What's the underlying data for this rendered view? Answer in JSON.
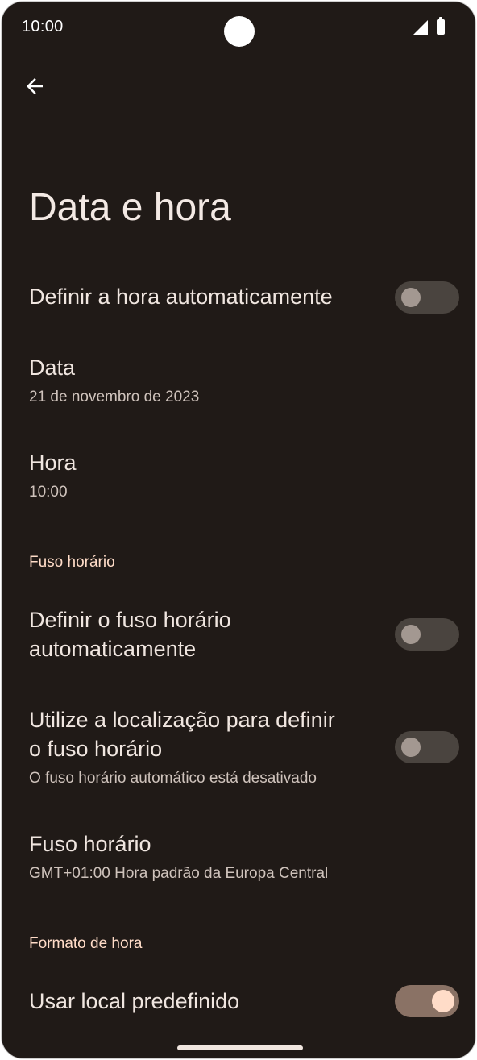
{
  "status_bar": {
    "time": "10:00"
  },
  "header": {
    "title": "Data e hora"
  },
  "settings": {
    "auto_time": {
      "label": "Definir a hora automaticamente",
      "enabled": false
    },
    "date": {
      "label": "Data",
      "value": "21 de novembro de 2023"
    },
    "time": {
      "label": "Hora",
      "value": "10:00"
    },
    "timezone_section": "Fuso horário",
    "auto_timezone": {
      "label_line1": "Definir o fuso horário",
      "label_line2": "automaticamente",
      "enabled": false
    },
    "location_timezone": {
      "label_line1": "Utilize a localização para definir",
      "label_line2": "o fuso horário",
      "summary": "O fuso horário automático está desativado",
      "enabled": false
    },
    "timezone": {
      "label": "Fuso horário",
      "value": "GMT+01:00 Hora padrão da Europa Central"
    },
    "format_section": "Formato de hora",
    "locale_default": {
      "label": "Usar local predefinido",
      "enabled": true
    }
  },
  "icons": {
    "back": "arrow-back-icon",
    "signal": "cell-signal-icon",
    "battery": "battery-icon"
  },
  "colors": {
    "background": "#201a17",
    "accent": "#ffdcc8",
    "switch_on_track": "#8a7265",
    "switch_off_track": "#4a443f"
  }
}
